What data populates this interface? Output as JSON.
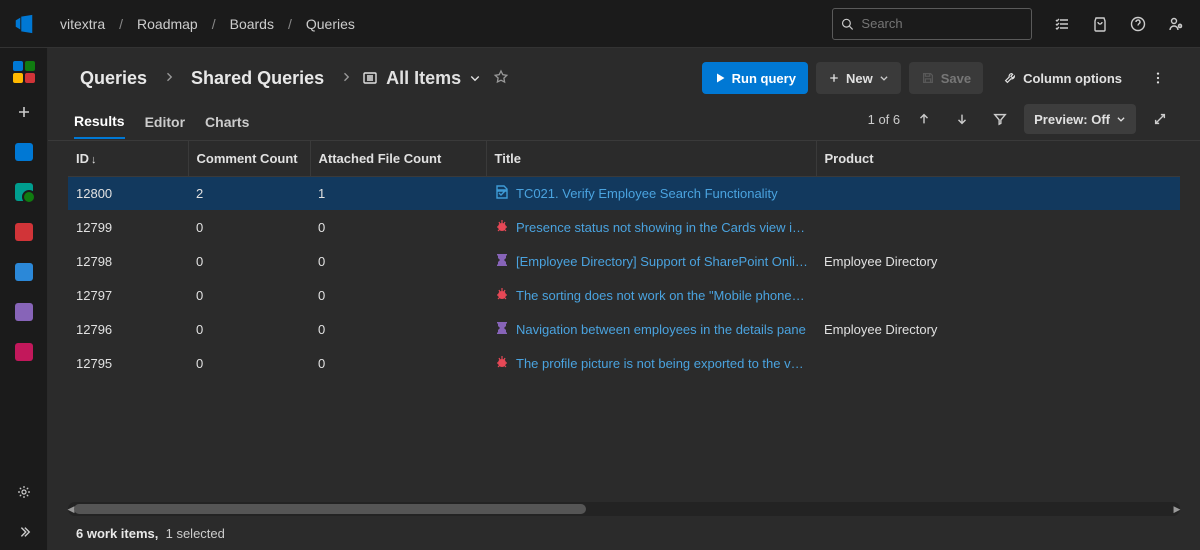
{
  "breadcrumb": {
    "items": [
      "vitextra",
      "Roadmap",
      "Boards",
      "Queries"
    ],
    "sep": "/"
  },
  "search": {
    "placeholder": "Search"
  },
  "header": {
    "path": [
      "Queries",
      "Shared Queries"
    ],
    "current": "All Items",
    "run_label": "Run query",
    "new_label": "New",
    "save_label": "Save",
    "columns_label": "Column options"
  },
  "tabs": {
    "results": "Results",
    "editor": "Editor",
    "charts": "Charts"
  },
  "toolbar": {
    "count": "1 of 6",
    "preview": "Preview: Off"
  },
  "columns": {
    "id": "ID",
    "comment_count": "Comment Count",
    "attached_file_count": "Attached File Count",
    "title": "Title",
    "product": "Product"
  },
  "rows": [
    {
      "id": "12800",
      "cc": "2",
      "af": "1",
      "type": "testcase",
      "title": "TC021. Verify Employee Search Functionality",
      "product": ""
    },
    {
      "id": "12799",
      "cc": "0",
      "af": "0",
      "type": "bug",
      "title": "Presence status not showing in the Cards view in c...",
      "product": ""
    },
    {
      "id": "12798",
      "cc": "0",
      "af": "0",
      "type": "epic",
      "title": "[Employee Directory] Support of SharePoint Online...",
      "product": "Employee Directory"
    },
    {
      "id": "12797",
      "cc": "0",
      "af": "0",
      "type": "bug",
      "title": "The sorting does not work on the \"Mobile phone\" ...",
      "product": ""
    },
    {
      "id": "12796",
      "cc": "0",
      "af": "0",
      "type": "epic",
      "title": "Navigation between employees in the details pane",
      "product": "Employee Directory"
    },
    {
      "id": "12795",
      "cc": "0",
      "af": "0",
      "type": "bug",
      "title": "The profile picture is not being exported to the vC...",
      "product": ""
    }
  ],
  "status": {
    "items": "6 work items,",
    "selected": "1 selected"
  }
}
